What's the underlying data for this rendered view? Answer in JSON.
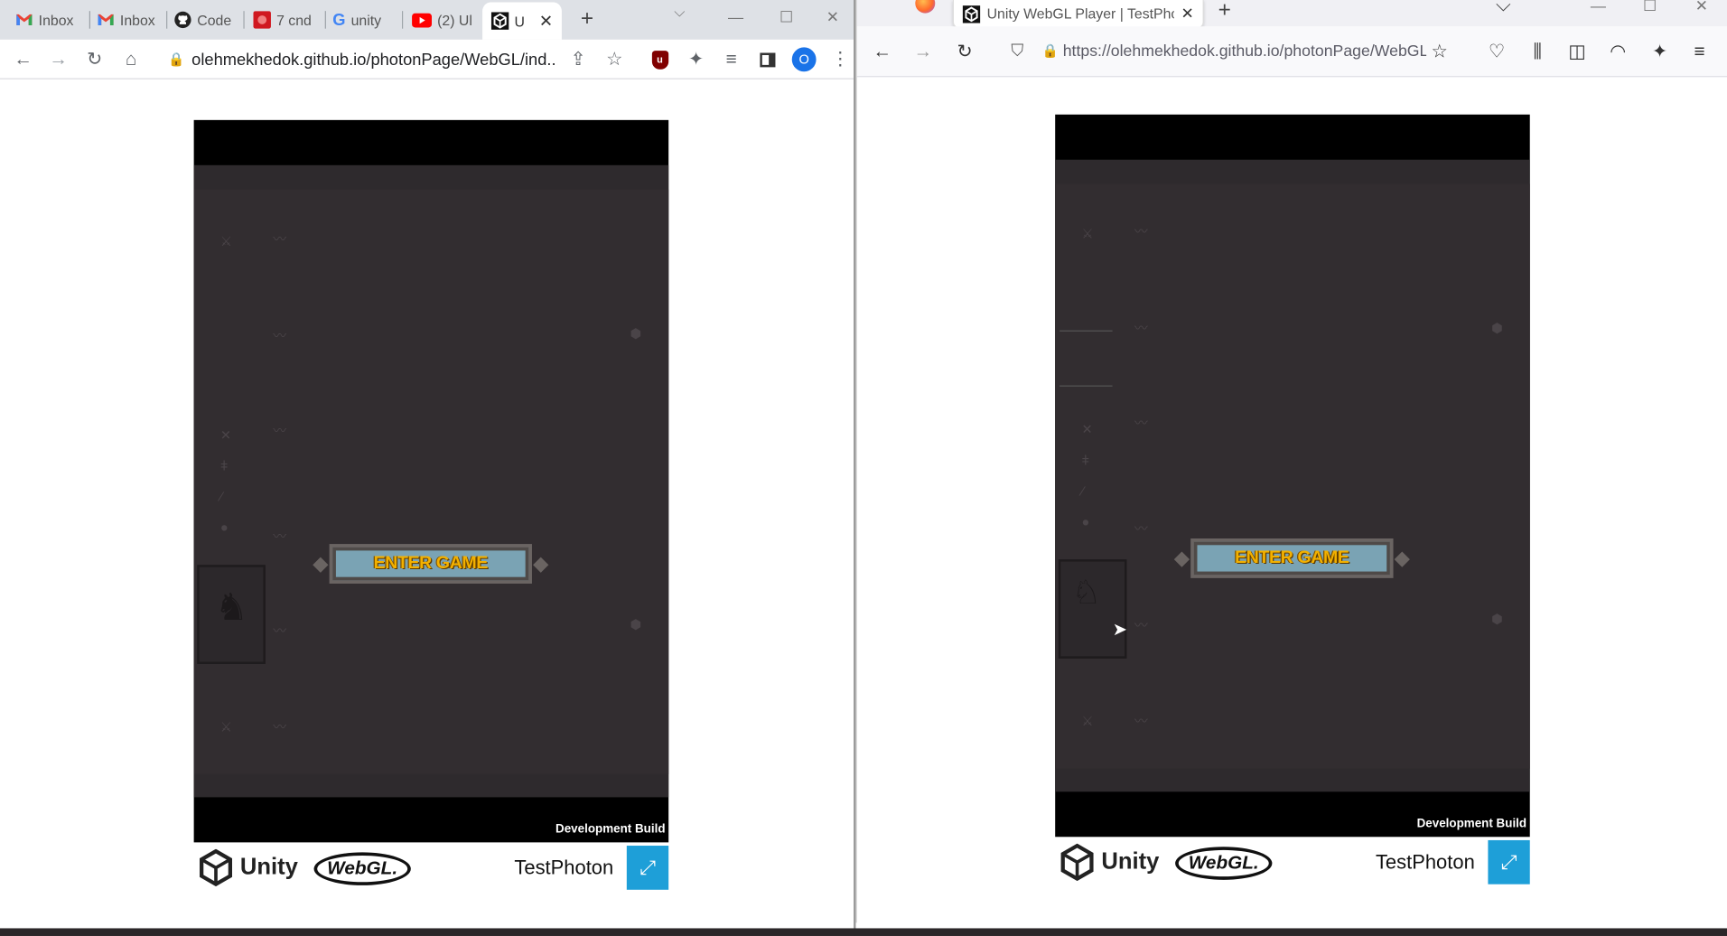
{
  "chrome": {
    "tabs": [
      {
        "title": "Inbox",
        "icon": "gmail-icon"
      },
      {
        "title": "Inbox",
        "icon": "gmail-icon"
      },
      {
        "title": "Code",
        "icon": "github-icon"
      },
      {
        "title": "7 cnd",
        "icon": "site-icon"
      },
      {
        "title": "unity",
        "icon": "google-icon"
      },
      {
        "title": "(2) Ul",
        "icon": "youtube-icon"
      },
      {
        "title": "U",
        "icon": "unity-icon",
        "active": true
      }
    ],
    "new_tab": "+",
    "url": "olehmekhedok.github.io/photonPage/WebGL/ind...",
    "profile_initial": "O"
  },
  "firefox": {
    "tab_title": "Unity WebGL Player | TestPhoton",
    "new_tab": "+",
    "url": "https://olehmekhedok.github.io/photonPage/WebGL"
  },
  "player": {
    "button_label": "ENTER GAME",
    "dev_build": "Development Build",
    "brand": "Unity",
    "webgl": "WebGL.",
    "title": "TestPhoton"
  },
  "colors": {
    "game_bg": "#322d30",
    "button_face": "#7aa3b4",
    "button_text": "#f2b000",
    "fullscreen": "#1e9fd8"
  }
}
